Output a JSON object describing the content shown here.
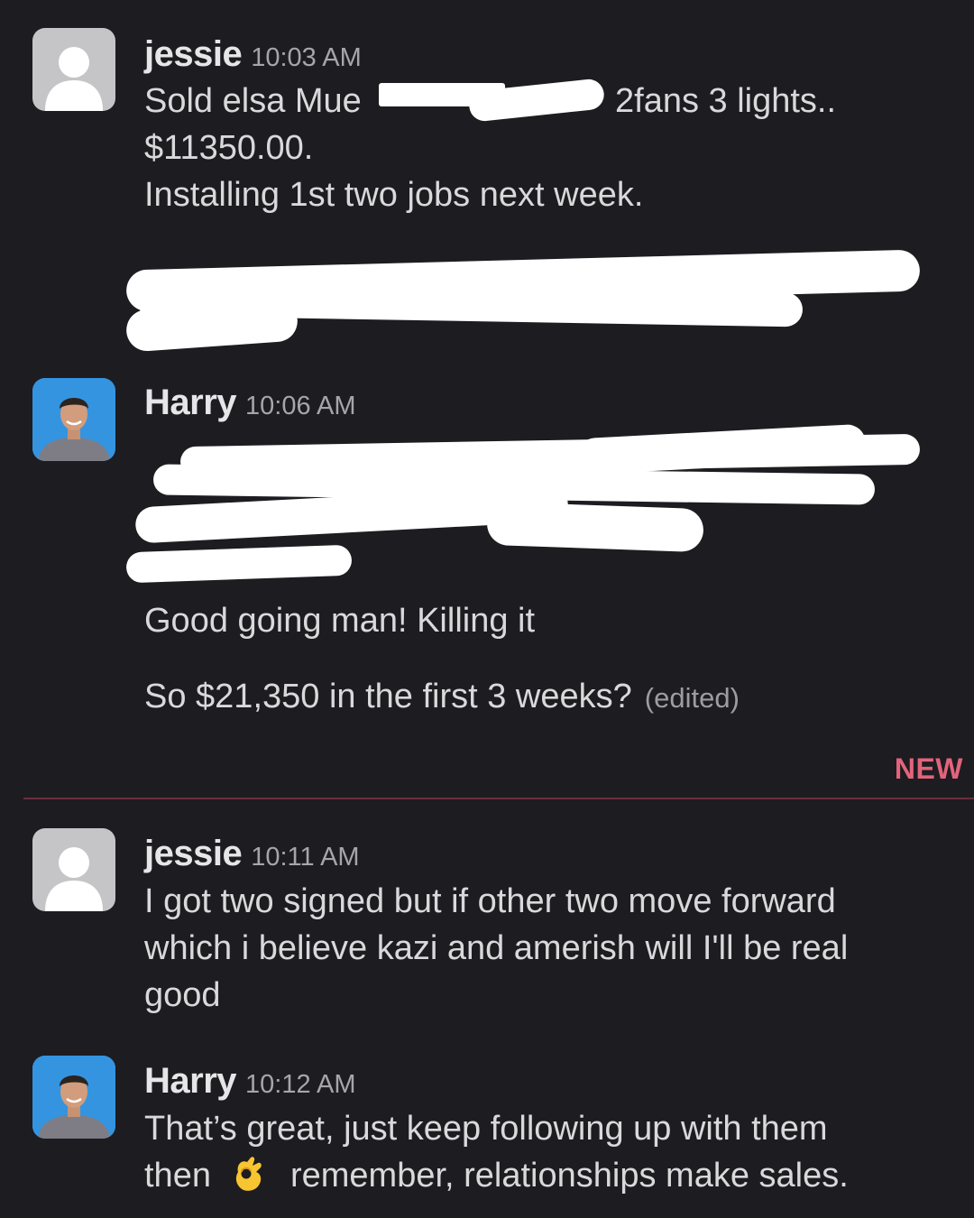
{
  "divider": {
    "label": "NEW"
  },
  "messages": [
    {
      "author": "jessie",
      "time": "10:03 AM",
      "avatar": "default-avatar-icon",
      "lines": [
        {
          "a": "Sold elsa Mue",
          "b": "2fans 3 lights.."
        },
        "$11350.00.",
        "Installing 1st two jobs next week."
      ]
    },
    {
      "author": "Harry",
      "time": "10:06 AM",
      "avatar": "profile-photo",
      "lines": [
        "Good going man! Killing it",
        "So $21,350 in the first 3 weeks?"
      ],
      "edited": "(edited)"
    },
    {
      "author": "jessie",
      "time": "10:11 AM",
      "avatar": "default-avatar-icon",
      "lines": [
        "I got two signed but if other two move forward",
        "which i believe  kazi and amerish will I'll be real",
        "good"
      ]
    },
    {
      "author": "Harry",
      "time": "10:12 AM",
      "avatar": "profile-photo",
      "lines": [
        "That’s great, just keep following up with them",
        {
          "a": "then",
          "emoji": "ok-hand-emoji",
          "b": "remember, relationships make sales."
        }
      ]
    }
  ],
  "colors": {
    "background": "#1d1c20",
    "new_divider": "#6a2f3e",
    "new_label": "#e2647c"
  }
}
